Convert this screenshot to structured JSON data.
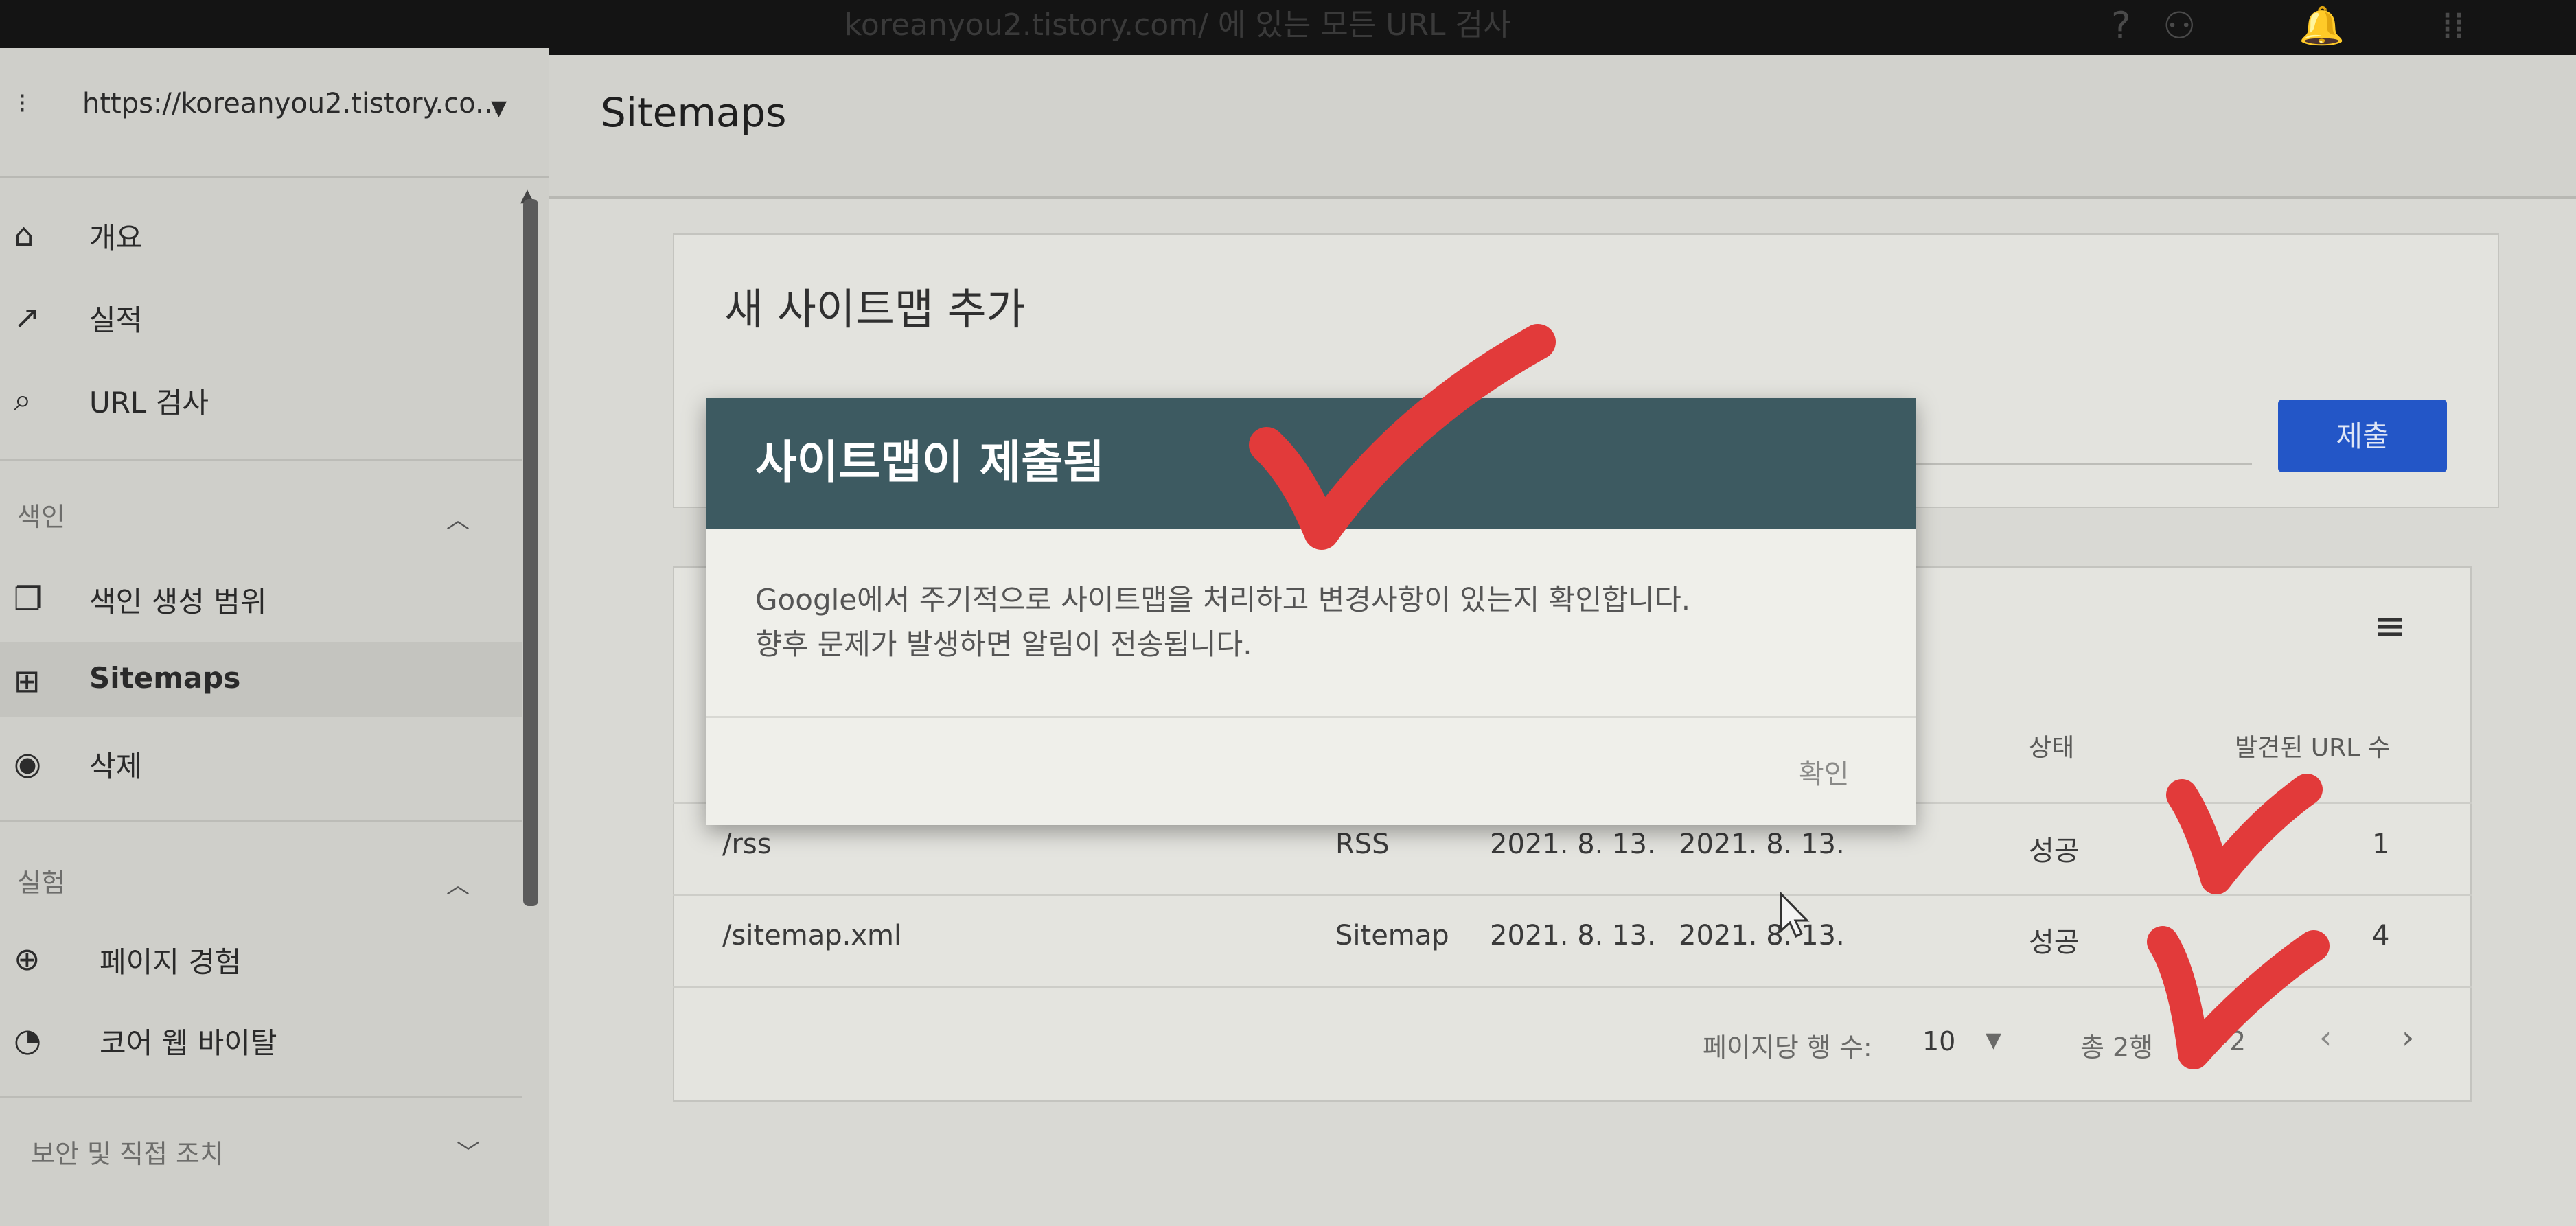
{
  "topbar": {
    "url_text": "koreanyou2.tistory.com/ 에 있는 모든 URL 검사",
    "icons": [
      "help-icon",
      "account-manage-icon",
      "bell-icon",
      "apps-icon"
    ]
  },
  "sidebar": {
    "property": "https://koreanyou2.tistory.co...",
    "items": [
      {
        "label": "개요",
        "icon": "home-icon"
      },
      {
        "label": "실적",
        "icon": "trending-icon"
      },
      {
        "label": "URL 검사",
        "icon": "search-icon"
      }
    ],
    "sections": [
      {
        "title": "색인",
        "items": [
          {
            "label": "색인 생성 범위",
            "icon": "copy-icon"
          },
          {
            "label": "Sitemaps",
            "icon": "sitemap-icon"
          },
          {
            "label": "삭제",
            "icon": "eye-off-icon"
          }
        ]
      },
      {
        "title": "실험",
        "items": [
          {
            "label": "페이지 경험",
            "icon": "plus-circle-icon"
          },
          {
            "label": "코어 웹 바이탈",
            "icon": "gauge-icon"
          }
        ]
      },
      {
        "title": "보안 및 직접 조치"
      }
    ]
  },
  "main": {
    "title": "Sitemaps",
    "add_card": {
      "title": "새 사이트맵 추가",
      "submit_label": "제출"
    },
    "table": {
      "headers": {
        "status": "상태",
        "found_urls": "발견된 URL 수"
      },
      "rows": [
        {
          "path": "/rss",
          "type": "RSS",
          "submitted": "2021. 8. 13.",
          "last_read": "2021. 8. 13.",
          "status": "성공",
          "count": "1"
        },
        {
          "path": "/sitemap.xml",
          "type": "Sitemap",
          "submitted": "2021. 8. 13.",
          "last_read": "2021. 8. 13.",
          "status": "성공",
          "count": "4"
        }
      ],
      "pager": {
        "rows_per_page_label": "페이지당 행 수:",
        "rows_per_page": "10",
        "total": "총 2행",
        "range": "~2"
      }
    }
  },
  "dialog": {
    "title": "사이트맵이 제출됨",
    "line1": "Google에서 주기적으로 사이트맵을 처리하고 변경사항이 있는지 확인합니다.",
    "line2": "향후 문제가 발생하면 알림이 전송됩니다.",
    "ok_label": "확인"
  },
  "colors": {
    "dialog_header": "#3d5a61",
    "submit_button": "#2356c7",
    "checkmark": "#e23a3a"
  }
}
